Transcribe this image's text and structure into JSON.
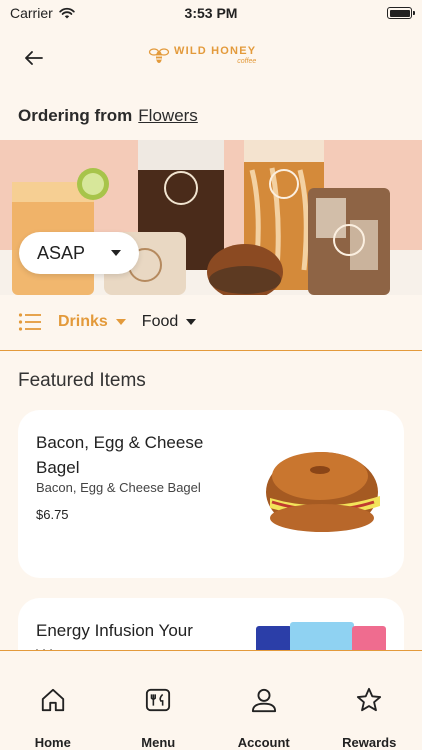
{
  "status": {
    "carrier": "Carrier",
    "time": "3:53 PM"
  },
  "header": {
    "logo_main": "WILD HONEY",
    "logo_sub": "coffee"
  },
  "ordering": {
    "label": "Ordering from",
    "store": "Flowers"
  },
  "pickup": {
    "time_label": "ASAP"
  },
  "tabs": [
    {
      "label": "Drinks",
      "active": true
    },
    {
      "label": "Food",
      "active": false
    }
  ],
  "featured": {
    "title": "Featured Items",
    "items": [
      {
        "name": "Bacon, Egg & Cheese Bagel",
        "description": "Bacon, Egg & Cheese Bagel",
        "price": "$6.75"
      },
      {
        "name": "Energy Infusion Your Way"
      }
    ]
  },
  "nav": [
    {
      "label": "Home",
      "icon": "home-icon"
    },
    {
      "label": "Menu",
      "icon": "menu-icon"
    },
    {
      "label": "Account",
      "icon": "account-icon"
    },
    {
      "label": "Rewards",
      "icon": "rewards-icon"
    }
  ],
  "colors": {
    "accent": "#e39a3b",
    "background": "#fdf6ee",
    "card": "#ffffff"
  }
}
